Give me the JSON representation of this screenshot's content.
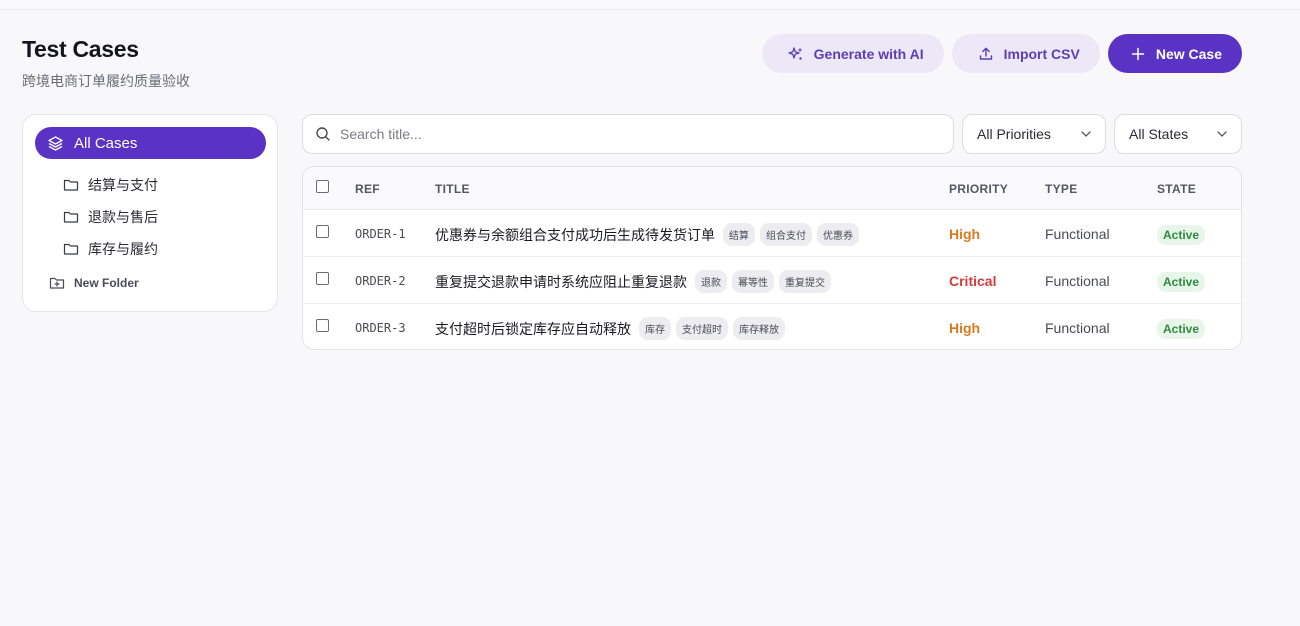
{
  "header": {
    "title": "Test Cases",
    "subtitle": "跨境电商订单履约质量验收"
  },
  "actions": {
    "generate_label": "Generate with AI",
    "import_label": "Import CSV",
    "new_case_label": "New Case"
  },
  "sidebar": {
    "all_cases_label": "All Cases",
    "folders": [
      {
        "label": "结算与支付"
      },
      {
        "label": "退款与售后"
      },
      {
        "label": "库存与履约"
      }
    ],
    "new_folder_label": "New Folder"
  },
  "filters": {
    "search_placeholder": "Search title...",
    "priority_value": "All Priorities",
    "state_value": "All States"
  },
  "table": {
    "columns": {
      "ref": "REF",
      "title": "TITLE",
      "priority": "PRIORITY",
      "type": "TYPE",
      "state": "STATE"
    },
    "rows": [
      {
        "ref": "ORDER-1",
        "title": "优惠券与余额组合支付成功后生成待发货订单",
        "tags": [
          "结算",
          "组合支付",
          "优惠券"
        ],
        "priority": "High",
        "type": "Functional",
        "state": "Active"
      },
      {
        "ref": "ORDER-2",
        "title": "重复提交退款申请时系统应阻止重复退款",
        "tags": [
          "退款",
          "幂等性",
          "重复提交"
        ],
        "priority": "Critical",
        "type": "Functional",
        "state": "Active"
      },
      {
        "ref": "ORDER-3",
        "title": "支付超时后锁定库存应自动释放",
        "tags": [
          "库存",
          "支付超时",
          "库存释放"
        ],
        "priority": "High",
        "type": "Functional",
        "state": "Active"
      }
    ]
  },
  "colors": {
    "accent": "#5b33c4",
    "priority_high": "#d97a1e",
    "priority_critical": "#d63a3a",
    "state_active": "#2e8b3e"
  }
}
